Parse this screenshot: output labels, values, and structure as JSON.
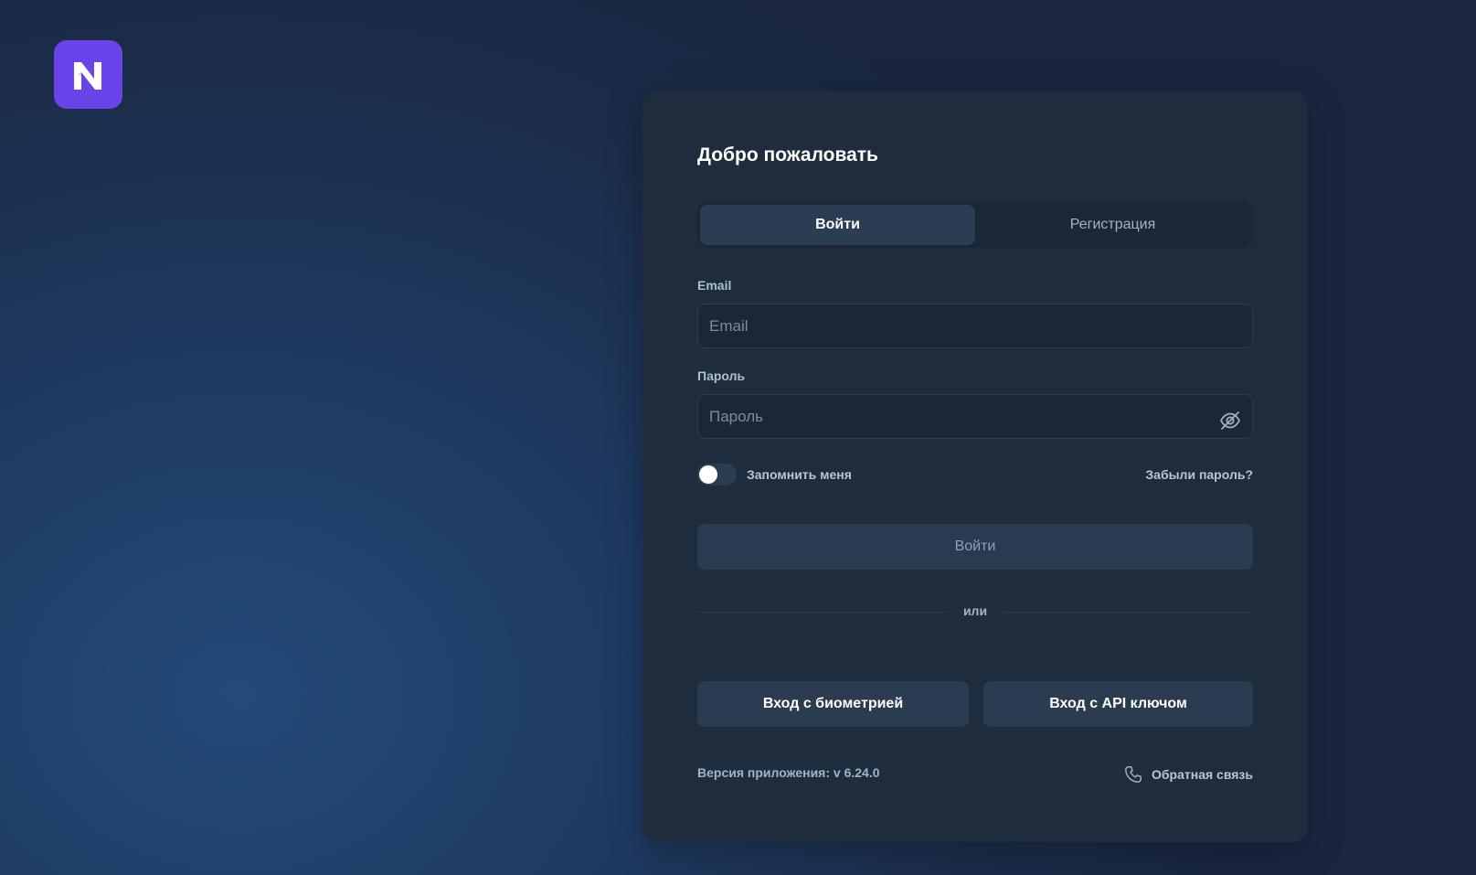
{
  "app": {
    "logo_letter": "N",
    "logo_color": "#6a44e8"
  },
  "login": {
    "title": "Добро пожаловать",
    "tabs": [
      {
        "label": "Войти",
        "active": true
      },
      {
        "label": "Регистрация",
        "active": false
      }
    ],
    "email": {
      "label": "Email",
      "placeholder": "Email",
      "value": ""
    },
    "password": {
      "label": "Пароль",
      "placeholder": "Пароль",
      "value": "",
      "visibility_icon": "eye-off-icon"
    },
    "remember_me": {
      "label": "Запомнить меня",
      "checked": false
    },
    "forgot_password": "Забыли пароль?",
    "submit_label": "Войти",
    "divider_text": "или",
    "biometric_label": "Вход с биометрией",
    "api_key_label": "Вход с API ключом",
    "version_text": "Версия приложения: v 6.24.0",
    "feedback_label": "Обратная связь",
    "feedback_icon": "phone-icon"
  },
  "colors": {
    "card_bg": "#1f2c3d",
    "accent": "#6a44e8",
    "input_bg": "#1b2735",
    "button_bg": "#2b3b50"
  }
}
